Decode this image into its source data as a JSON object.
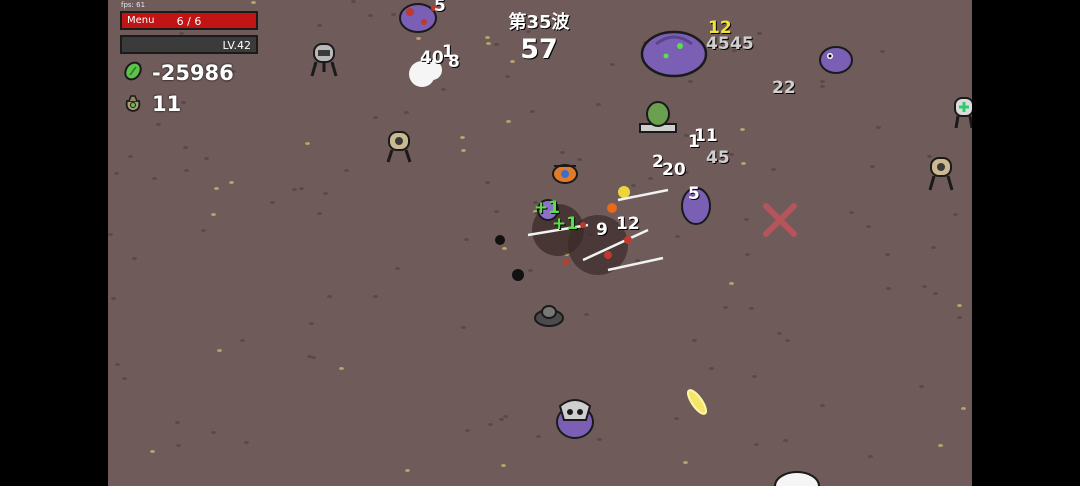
{
  "hud": {
    "fps": "fps: 61",
    "menu_label": "Menu",
    "hp_text": "6 / 6",
    "hp_fraction": 1.0,
    "level_text": "LV.42",
    "xp_fraction": 0.0,
    "materials": "-25986",
    "bag_count": "11",
    "wave": "第35波",
    "timer": "57"
  },
  "damage_numbers": {
    "d1": "40",
    "d2": "1",
    "d3": "8",
    "d4": "12",
    "d5": "45",
    "d6": "45",
    "d7": "22",
    "d8": "11",
    "d9": "1",
    "d10": "45",
    "d11": "20",
    "d12": "5",
    "d13": "+1",
    "d14": "+1",
    "d15": "9",
    "d16": "12",
    "d17": "2",
    "d18": "5"
  },
  "colors": {
    "ground": "#6e5b5a",
    "hp_red": "#c11414",
    "enemy_purple": "#7b5fb5",
    "material_green": "#58e04a",
    "damage_yellow": "#f2e23a"
  },
  "icons": {
    "materials": "green-material-icon",
    "bag": "material-bag-icon"
  }
}
